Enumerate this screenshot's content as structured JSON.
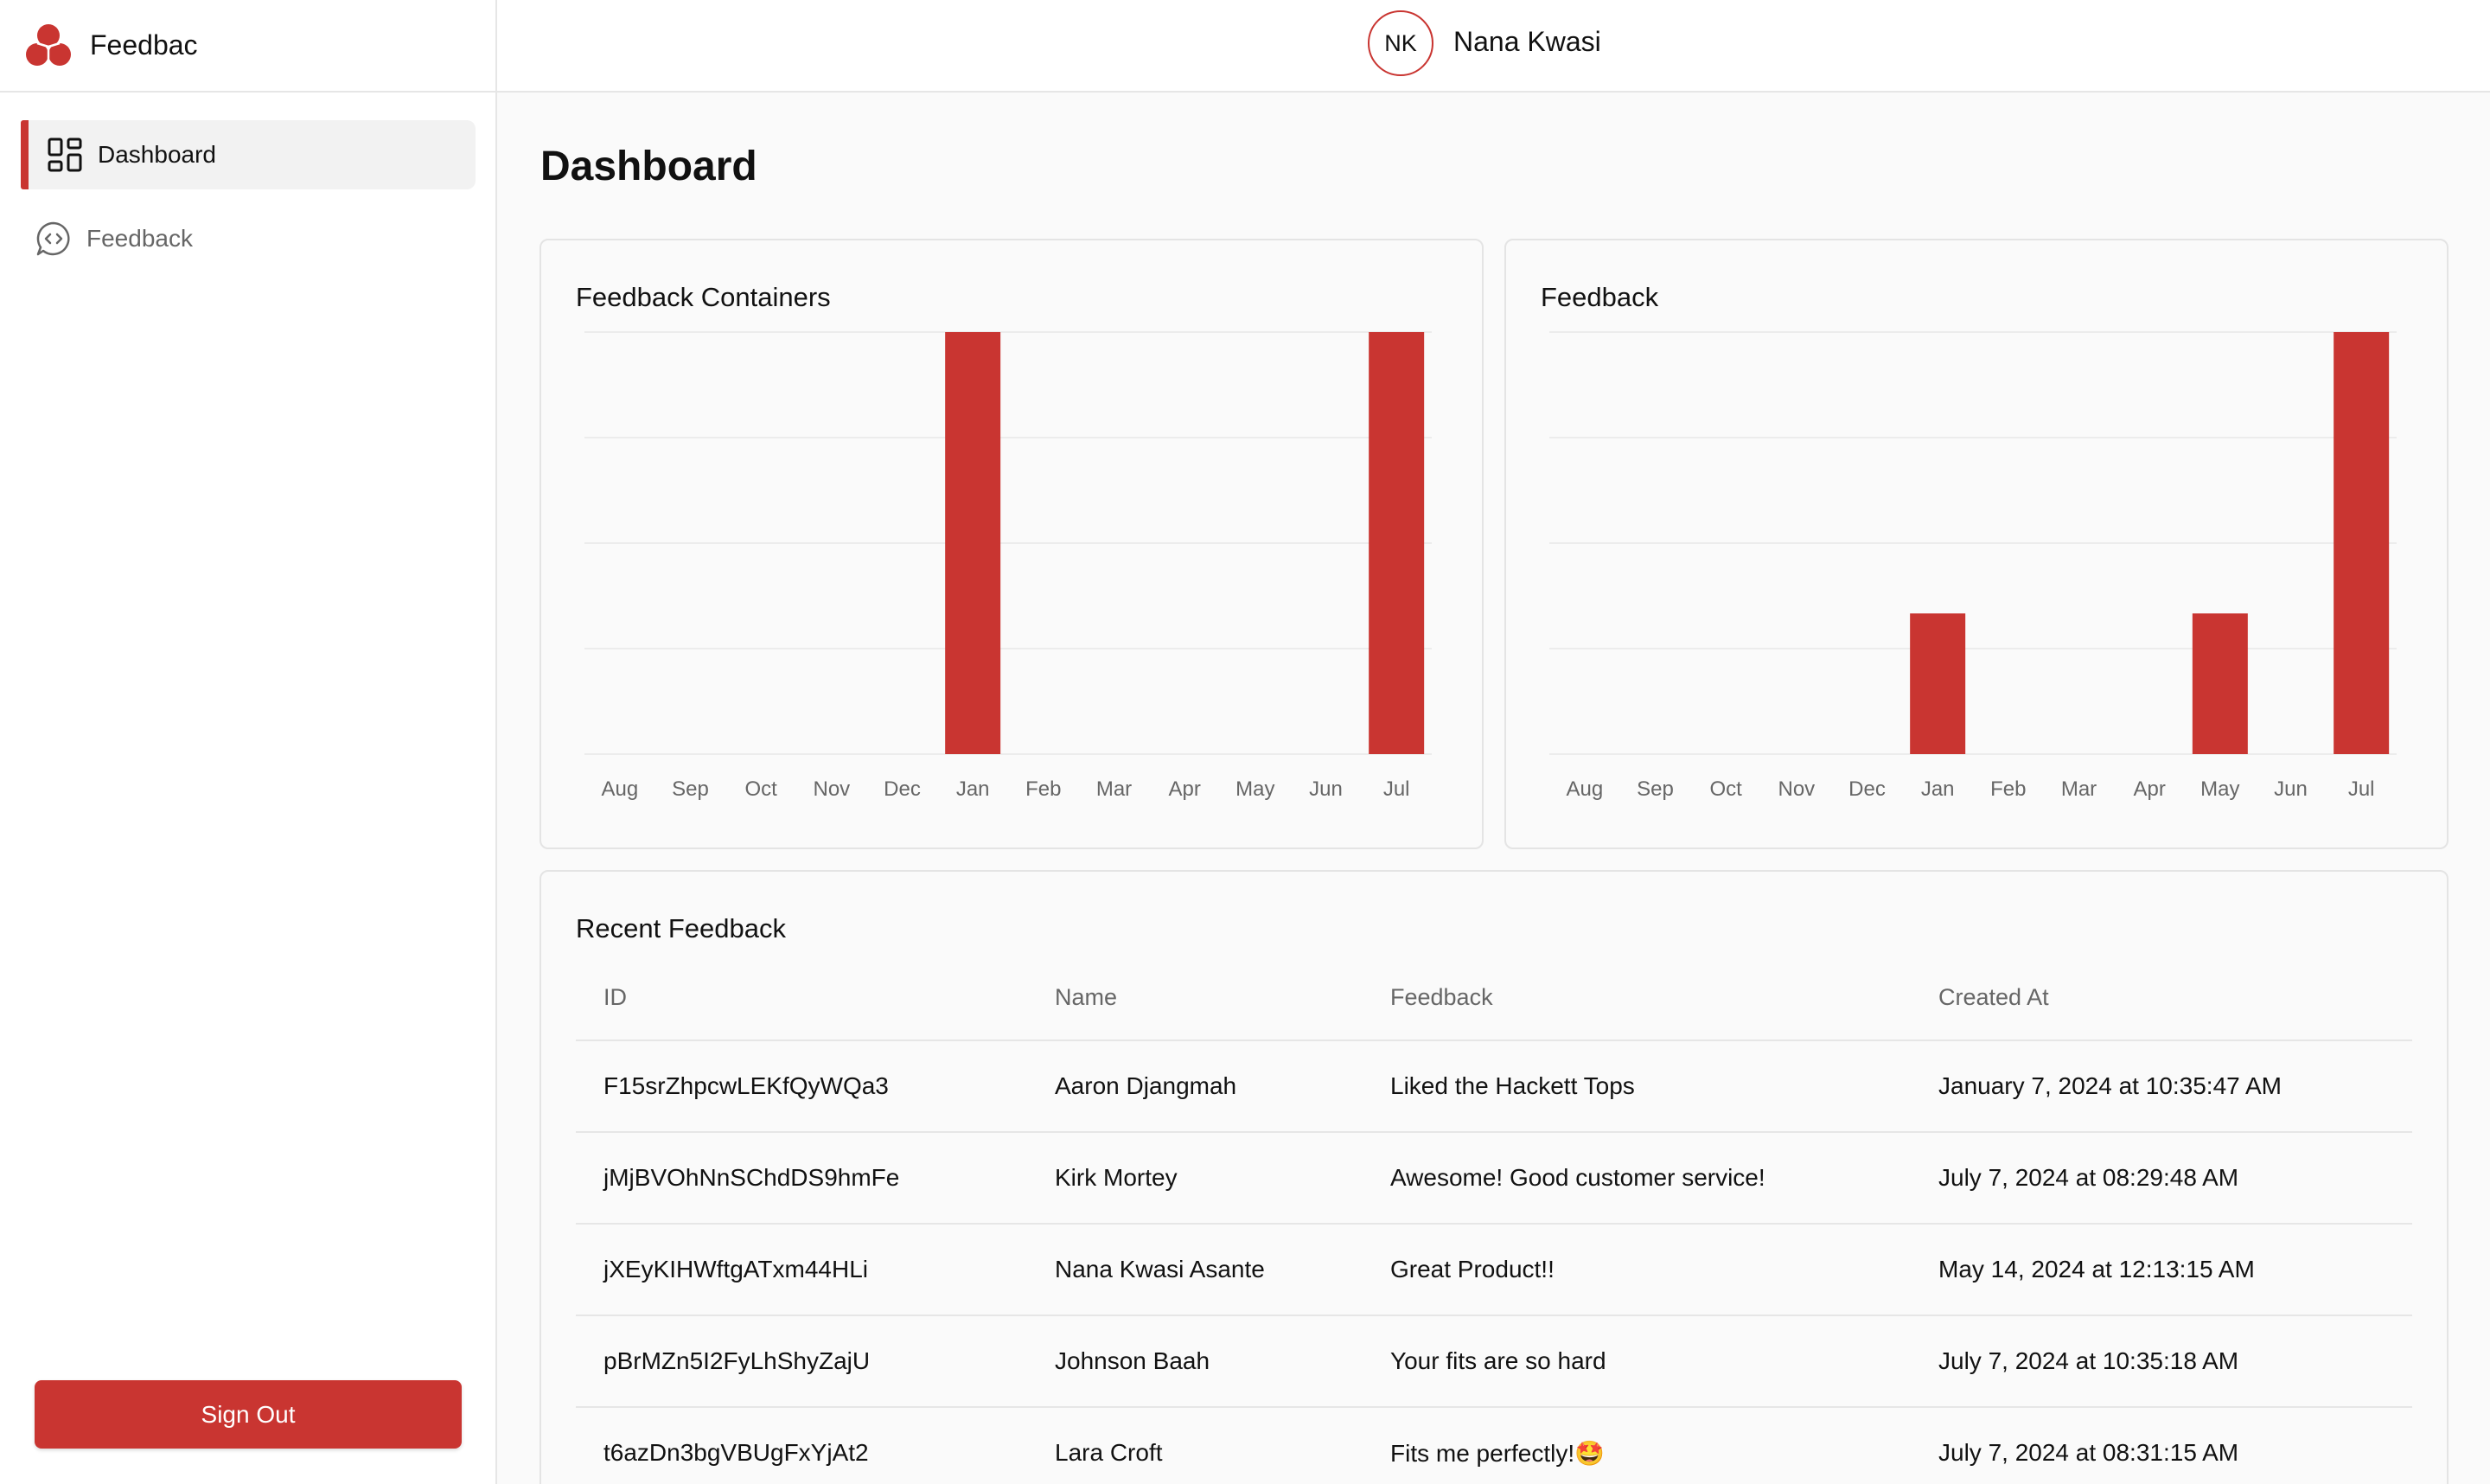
{
  "app": {
    "name": "Feedbac"
  },
  "user": {
    "initials": "NK",
    "name": "Nana Kwasi"
  },
  "sidebar": {
    "items": [
      {
        "label": "Dashboard",
        "icon": "dashboard-grid-icon",
        "active": true
      },
      {
        "label": "Feedback",
        "icon": "chat-code-icon",
        "active": false
      }
    ],
    "sign_out_label": "Sign Out"
  },
  "page": {
    "title": "Dashboard"
  },
  "colors": {
    "accent": "#c93531",
    "grid": "#ececec",
    "axis_text": "#666666"
  },
  "chart_data": [
    {
      "type": "bar",
      "title": "Feedback Containers",
      "categories": [
        "Aug",
        "Sep",
        "Oct",
        "Nov",
        "Dec",
        "Jan",
        "Feb",
        "Mar",
        "Apr",
        "May",
        "Jun",
        "Jul"
      ],
      "values": [
        0,
        0,
        0,
        0,
        0,
        1,
        0,
        0,
        0,
        0,
        0,
        1
      ],
      "ylim": [
        0,
        1
      ],
      "grid": true
    },
    {
      "type": "bar",
      "title": "Feedback",
      "categories": [
        "Aug",
        "Sep",
        "Oct",
        "Nov",
        "Dec",
        "Jan",
        "Feb",
        "Mar",
        "Apr",
        "May",
        "Jun",
        "Jul"
      ],
      "values": [
        0,
        0,
        0,
        0,
        0,
        1,
        0,
        0,
        0,
        1,
        0,
        3
      ],
      "ylim": [
        0,
        3
      ],
      "grid": true
    }
  ],
  "recent_feedback": {
    "title": "Recent Feedback",
    "columns": [
      "ID",
      "Name",
      "Feedback",
      "Created At"
    ],
    "rows": [
      {
        "id": "F15srZhpcwLEKfQyWQa3",
        "name": "Aaron Djangmah",
        "feedback": "Liked the Hackett Tops",
        "created_at": "January 7, 2024 at 10:35:47 AM"
      },
      {
        "id": "jMjBVOhNnSChdDS9hmFe",
        "name": "Kirk Mortey",
        "feedback": "Awesome! Good customer service!",
        "created_at": "July 7, 2024 at 08:29:48 AM"
      },
      {
        "id": "jXEyKIHWftgATxm44HLi",
        "name": "Nana Kwasi Asante",
        "feedback": "Great Product!!",
        "created_at": "May 14, 2024 at 12:13:15 AM"
      },
      {
        "id": "pBrMZn5I2FyLhShyZajU",
        "name": "Johnson Baah",
        "feedback": "Your fits are so hard",
        "created_at": "July 7, 2024 at 10:35:18 AM"
      },
      {
        "id": "t6azDn3bgVBUgFxYjAt2",
        "name": "Lara Croft",
        "feedback": "Fits me perfectly!🤩",
        "created_at": "July 7, 2024 at 08:31:15 AM"
      }
    ]
  }
}
